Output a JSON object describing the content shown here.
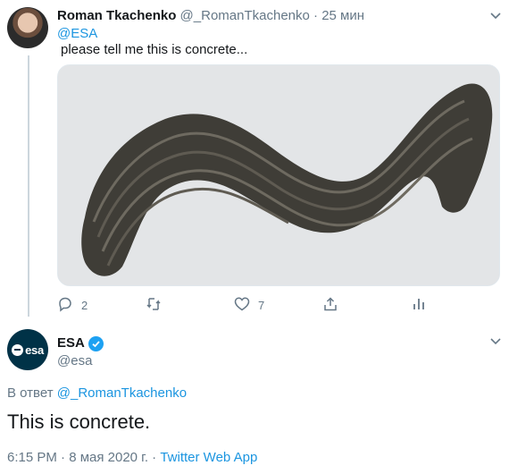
{
  "tweet1": {
    "display_name": "Roman Tkachenko",
    "handle": "@_RomanTkachenko",
    "separator": "·",
    "time": "25 мин",
    "mention": "@ESA",
    "text": "please tell me this is concrete...",
    "actions": {
      "reply_icon": "reply-icon",
      "reply_count": "2",
      "retweet_icon": "retweet-icon",
      "like_icon": "heart-icon",
      "like_count": "7",
      "share_icon": "share-icon",
      "analytics_icon": "analytics-icon"
    }
  },
  "tweet2": {
    "display_name": "ESA",
    "handle": "@esa",
    "avatar_text": "esa",
    "verified_icon": "verified-badge-icon",
    "reply_prefix": "В ответ",
    "reply_to": "@_RomanTkachenko",
    "text": "This is concrete.",
    "timestamp": "6:15 PM · 8 мая 2020 г.",
    "meta_separator": "·",
    "source": "Twitter Web App"
  },
  "colors": {
    "link_blue": "#1b95e0",
    "muted_gray": "#657786",
    "text_dark": "#14171a",
    "verified_blue": "#1da1f2",
    "esa_navy": "#003247",
    "concrete_dark": "#3f3d37"
  }
}
